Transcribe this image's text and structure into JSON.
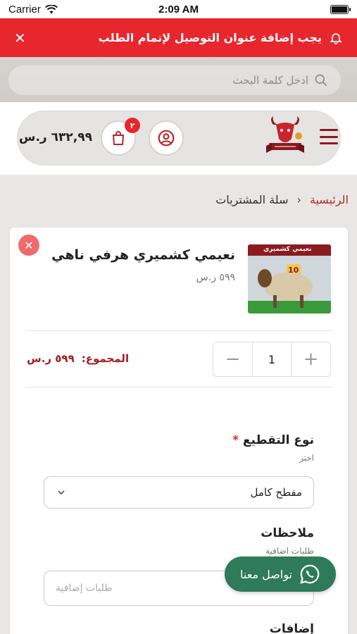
{
  "status_bar": {
    "carrier": "Carrier",
    "time": "2:09 AM"
  },
  "alert": {
    "message": "يجب إضافة عنوان التوصيل لإتمام الطلب"
  },
  "search": {
    "placeholder": "ادخل كلمة البحث"
  },
  "header": {
    "cart_total": "٦٣٢,٩٩ ر.س",
    "cart_count": "٢"
  },
  "breadcrumb": {
    "home": "الرئيسية",
    "separator": "›",
    "current": "سلة المشتريات"
  },
  "cart_item": {
    "name": "نعيمي كشميري هرفي ناهي",
    "price": "٥٩٩ ر.س",
    "image_label": "نعيمي كشميري",
    "image_badge": "10",
    "quantity": "1",
    "subtotal_label": "المجموع:",
    "subtotal_value": "٥٩٩ ر.س"
  },
  "form": {
    "cut_type_label": "نوع التقطيع",
    "cut_type_hint": "اختر",
    "cut_type_value": "مفطح كامل",
    "notes_label": "ملاحظات",
    "notes_hint": "طلبات اضافية",
    "notes_placeholder": "طلبات إضافية",
    "addons_label": "إضافات"
  },
  "whatsapp": {
    "label": "تواصل معنا"
  },
  "colors": {
    "primary_red": "#e8262d",
    "brand_dark_red": "#8b1a1f",
    "whatsapp_green": "#2e7a5a"
  }
}
